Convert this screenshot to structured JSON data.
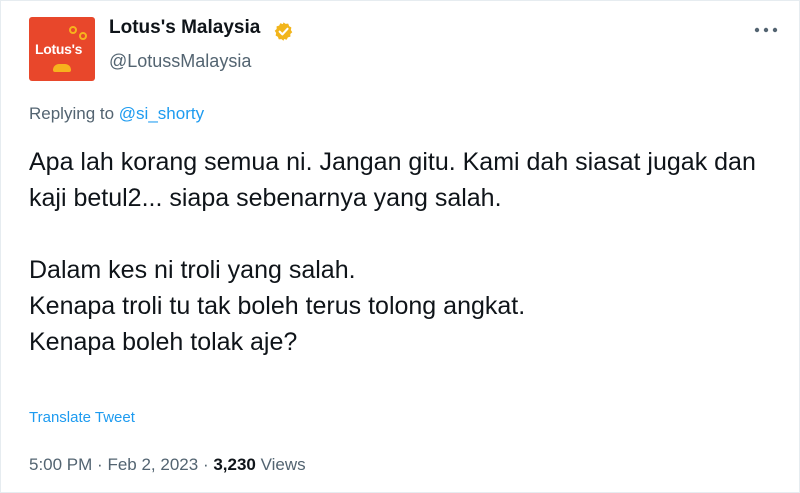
{
  "author": {
    "avatar_logo_text": "Lotus's",
    "display_name": "Lotus's Malaysia",
    "handle": "@LotussMalaysia",
    "verified_color": "#f2b51b"
  },
  "reply": {
    "prefix": "Replying to",
    "mention": "@si_shorty"
  },
  "tweet": {
    "paragraph1": "Apa lah korang semua ni. Jangan gitu. Kami dah siasat jugak dan kaji betul2... siapa sebenarnya yang salah.",
    "line2": "Dalam kes ni troli yang salah.",
    "line3": "Kenapa troli tu tak boleh terus tolong angkat.",
    "line4": "Kenapa boleh tolak aje?"
  },
  "translate_label": "Translate Tweet",
  "meta": {
    "time": "5:00 PM",
    "separator": "·",
    "date": "Feb 2, 2023",
    "views_count": "3,230",
    "views_label": "Views"
  },
  "icons": {
    "more": "more-horizontal-icon",
    "verified": "verified-badge-icon"
  },
  "colors": {
    "brand": "#e8472b",
    "link": "#1d9bf0",
    "secondary_text": "#536471",
    "primary_text": "#0f1419"
  }
}
